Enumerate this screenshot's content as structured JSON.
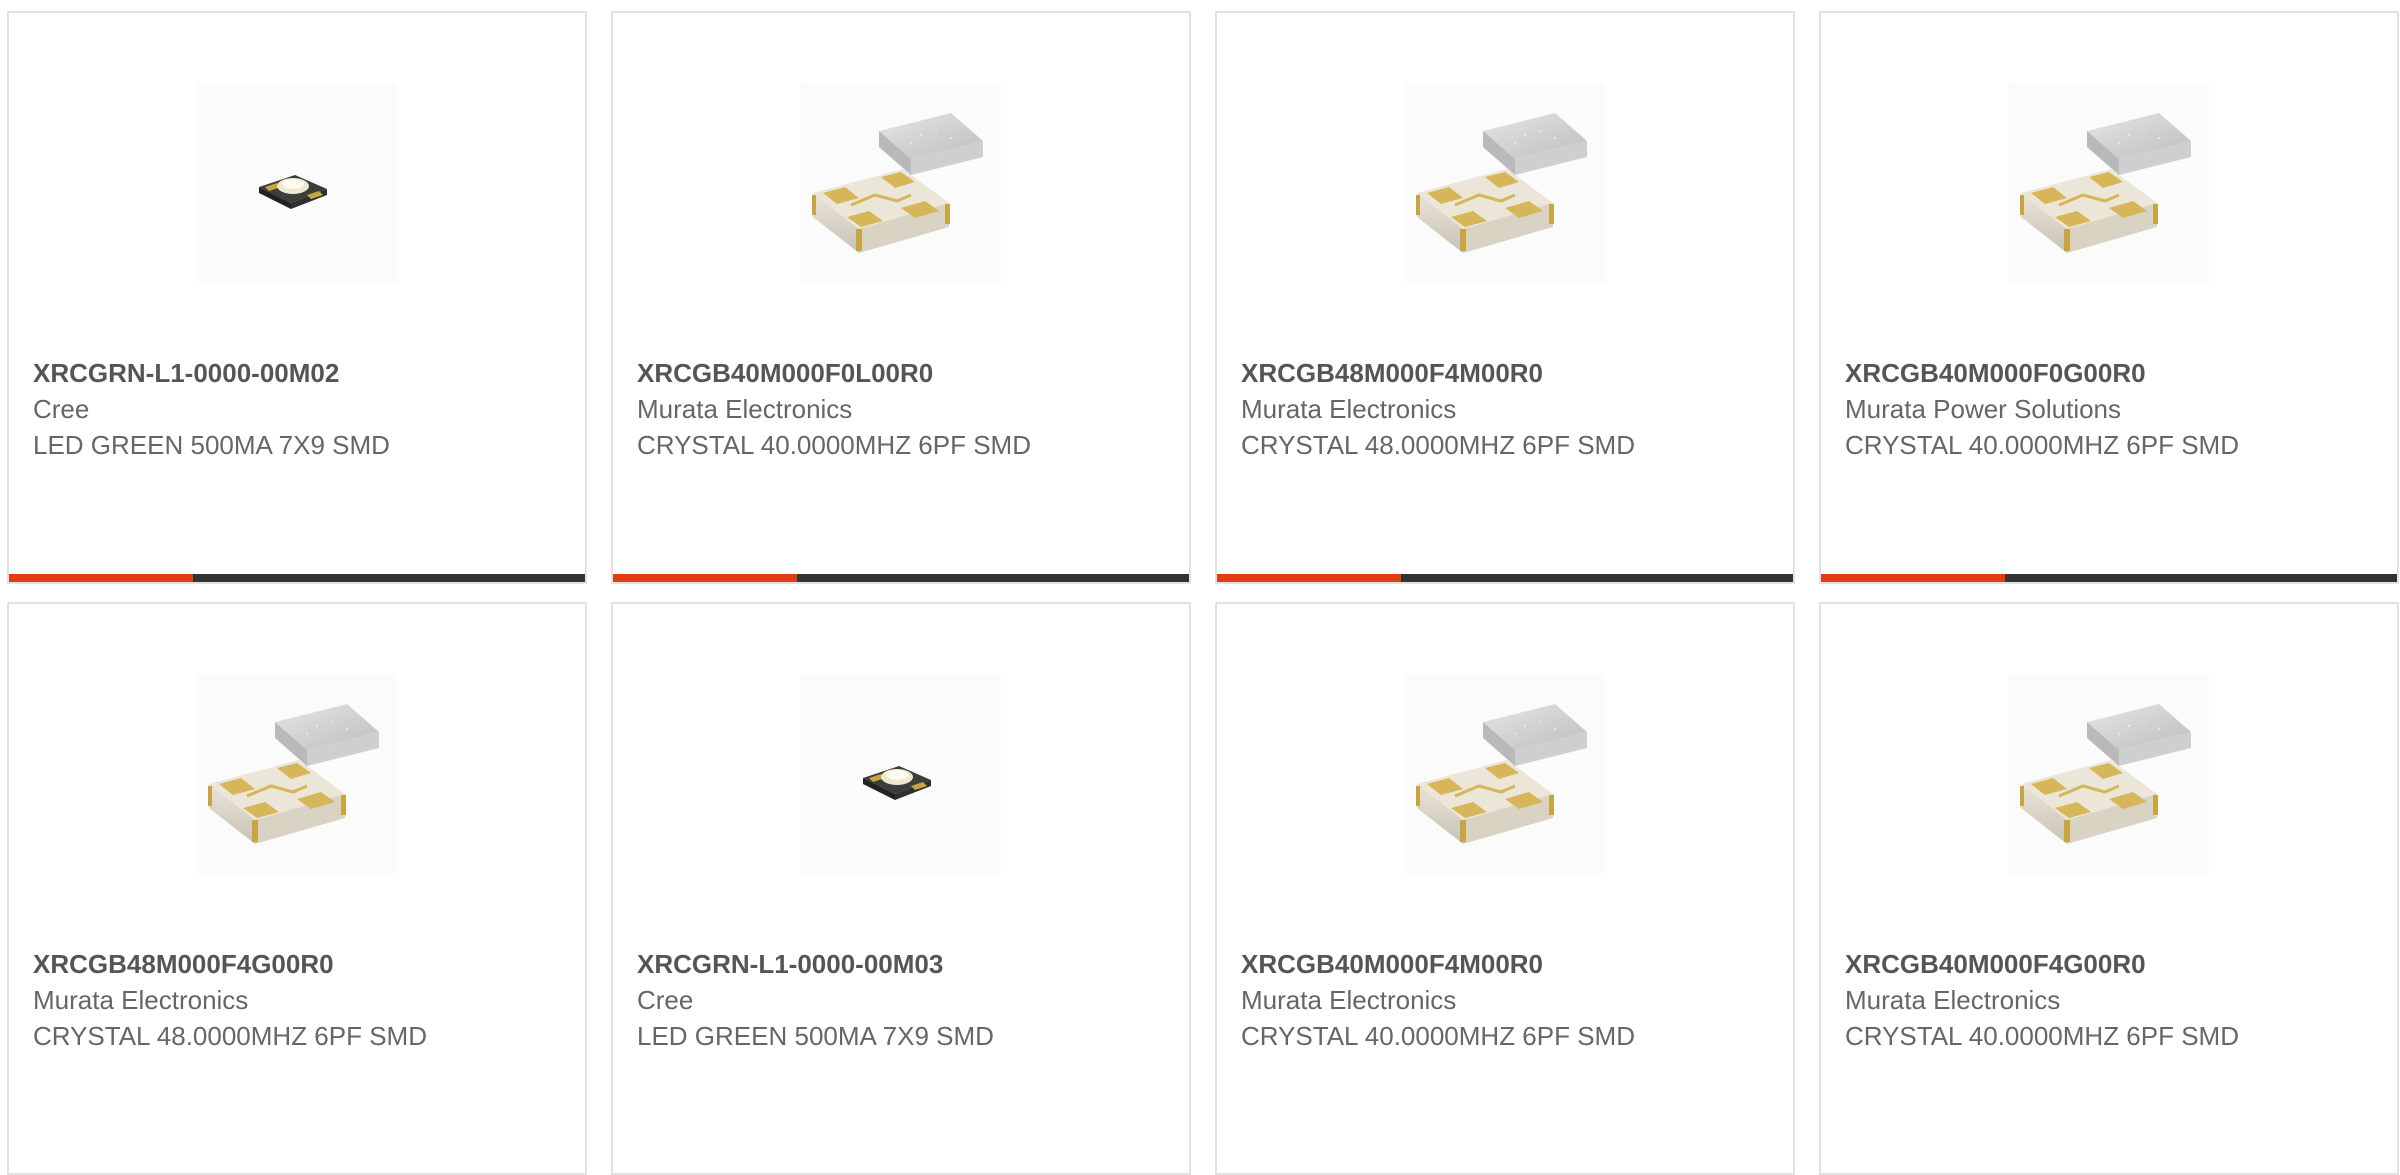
{
  "colors": {
    "accent": "#e03d13",
    "bar_dark": "#333333",
    "card_border": "#e2e2e2",
    "text": "#666666"
  },
  "products": [
    {
      "part_number": "XRCGRN-L1-0000-00M02",
      "manufacturer": "Cree",
      "description": "LED GREEN 500MA 7X9 SMD",
      "image_icon": "led-icon",
      "bar_fill_fraction": 0.32
    },
    {
      "part_number": "XRCGB40M000F0L00R0",
      "manufacturer": "Murata Electronics",
      "description": "CRYSTAL 40.0000MHZ 6PF SMD",
      "image_icon": "crystal-icon",
      "bar_fill_fraction": 0.32
    },
    {
      "part_number": "XRCGB48M000F4M00R0",
      "manufacturer": "Murata Electronics",
      "description": "CRYSTAL 48.0000MHZ 6PF SMD",
      "image_icon": "crystal-icon",
      "bar_fill_fraction": 0.32
    },
    {
      "part_number": "XRCGB40M000F0G00R0",
      "manufacturer": "Murata Power Solutions",
      "description": "CRYSTAL 40.0000MHZ 6PF SMD",
      "image_icon": "crystal-icon",
      "bar_fill_fraction": 0.32
    },
    {
      "part_number": "XRCGB48M000F4G00R0",
      "manufacturer": "Murata Electronics",
      "description": "CRYSTAL 48.0000MHZ 6PF SMD",
      "image_icon": "crystal-icon"
    },
    {
      "part_number": "XRCGRN-L1-0000-00M03",
      "manufacturer": "Cree",
      "description": "LED GREEN 500MA 7X9 SMD",
      "image_icon": "led-icon"
    },
    {
      "part_number": "XRCGB40M000F4M00R0",
      "manufacturer": "Murata Electronics",
      "description": "CRYSTAL 40.0000MHZ 6PF SMD",
      "image_icon": "crystal-icon"
    },
    {
      "part_number": "XRCGB40M000F4G00R0",
      "manufacturer": "Murata Electronics",
      "description": "CRYSTAL 40.0000MHZ 6PF SMD",
      "image_icon": "crystal-icon"
    }
  ]
}
